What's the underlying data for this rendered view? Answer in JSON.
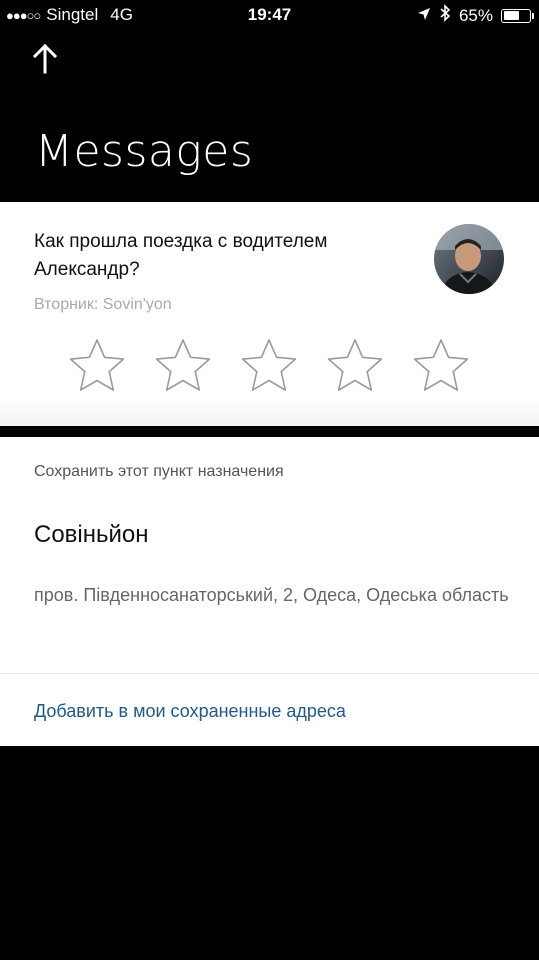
{
  "status_bar": {
    "signal": "●●●○○",
    "carrier": "Singtel",
    "network": "4G",
    "time": "19:47",
    "battery_text": "65%",
    "battery_level": 0.65
  },
  "header": {
    "title": "Messages"
  },
  "rating_card": {
    "question": "Как прошла поездка с водителем Александр?",
    "meta": "Вторник: Sovin'yon",
    "stars_total": 5,
    "stars_selected": 0
  },
  "save_card": {
    "label": "Сохранить этот пункт назначения",
    "place_name": "Совіньйон",
    "address": "пров. Південносанаторський, 2, Одеса, Одеська область",
    "add_link": "Добавить в мои сохраненные адреса"
  },
  "colors": {
    "background": "#000000",
    "card": "#ffffff",
    "link": "#215a8a",
    "muted": "#aaaaaa"
  }
}
